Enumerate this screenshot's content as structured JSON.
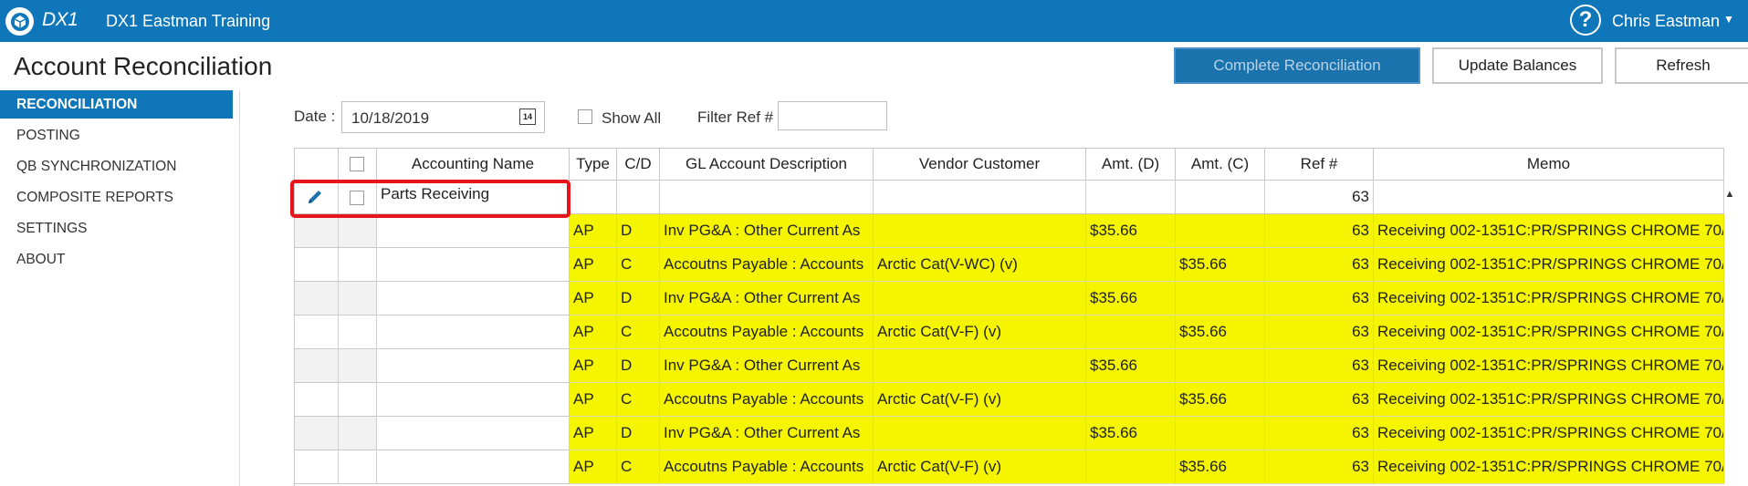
{
  "app": {
    "logo_text": "DX1",
    "title": "DX1 Eastman Training",
    "help_symbol": "?",
    "user_name": "Chris Eastman",
    "caret": "▼",
    "brand_color": "#0f76b9"
  },
  "page": {
    "title": "Account Reconciliation"
  },
  "actions": {
    "complete": "Complete Reconciliation",
    "update": "Update Balances",
    "refresh": "Refresh"
  },
  "sidebar": {
    "items": [
      {
        "label": "RECONCILIATION",
        "active": true
      },
      {
        "label": "POSTING"
      },
      {
        "label": "QB SYNCHRONIZATION"
      },
      {
        "label": "COMPOSITE REPORTS"
      },
      {
        "label": "SETTINGS"
      },
      {
        "label": "ABOUT"
      }
    ]
  },
  "filters": {
    "date_label": "Date :",
    "date_value": "10/18/2019",
    "calendar_icon_text": "14",
    "show_all_label": "Show All",
    "filter_ref_label": "Filter Ref #",
    "filter_ref_value": ""
  },
  "grid": {
    "columns": [
      "",
      "",
      "Accounting Name",
      "Type",
      "C/D",
      "GL Account Description",
      "Vendor Customer",
      "Amt. (D)",
      "Amt. (C)",
      "Ref #",
      "Memo"
    ],
    "group_row": {
      "accounting_name": "Parts Receiving",
      "ref": "63"
    },
    "rows": [
      {
        "type": "AP",
        "cd": "D",
        "gl": "Inv PG&A : Other Current As",
        "vendor": "",
        "amt_d": "$35.66",
        "amt_c": "",
        "ref": "63",
        "memo": "Receiving 002-1351C:PR/SPRINGS CHROME 70/"
      },
      {
        "type": "AP",
        "cd": "C",
        "gl": "Accoutns Payable : Accounts",
        "vendor": "Arctic Cat(V-WC) (v)",
        "amt_d": "",
        "amt_c": "$35.66",
        "ref": "63",
        "memo": "Receiving 002-1351C:PR/SPRINGS CHROME 70/"
      },
      {
        "type": "AP",
        "cd": "D",
        "gl": "Inv PG&A : Other Current As",
        "vendor": "",
        "amt_d": "$35.66",
        "amt_c": "",
        "ref": "63",
        "memo": "Receiving 002-1351C:PR/SPRINGS CHROME 70/"
      },
      {
        "type": "AP",
        "cd": "C",
        "gl": "Accoutns Payable : Accounts",
        "vendor": "Arctic Cat(V-F) (v)",
        "amt_d": "",
        "amt_c": "$35.66",
        "ref": "63",
        "memo": "Receiving 002-1351C:PR/SPRINGS CHROME 70/"
      },
      {
        "type": "AP",
        "cd": "D",
        "gl": "Inv PG&A : Other Current As",
        "vendor": "",
        "amt_d": "$35.66",
        "amt_c": "",
        "ref": "63",
        "memo": "Receiving 002-1351C:PR/SPRINGS CHROME 70/"
      },
      {
        "type": "AP",
        "cd": "C",
        "gl": "Accoutns Payable : Accounts",
        "vendor": "Arctic Cat(V-F) (v)",
        "amt_d": "",
        "amt_c": "$35.66",
        "ref": "63",
        "memo": "Receiving 002-1351C:PR/SPRINGS CHROME 70/"
      },
      {
        "type": "AP",
        "cd": "D",
        "gl": "Inv PG&A : Other Current As",
        "vendor": "",
        "amt_d": "$35.66",
        "amt_c": "",
        "ref": "63",
        "memo": "Receiving 002-1351C:PR/SPRINGS CHROME 70/"
      },
      {
        "type": "AP",
        "cd": "C",
        "gl": "Accoutns Payable : Accounts",
        "vendor": "Arctic Cat(V-F) (v)",
        "amt_d": "",
        "amt_c": "$35.66",
        "ref": "63",
        "memo": "Receiving 002-1351C:PR/SPRINGS CHROME 70/"
      }
    ],
    "row_highlight_color": "#f5f500",
    "annotation_color": "#e8141c"
  }
}
